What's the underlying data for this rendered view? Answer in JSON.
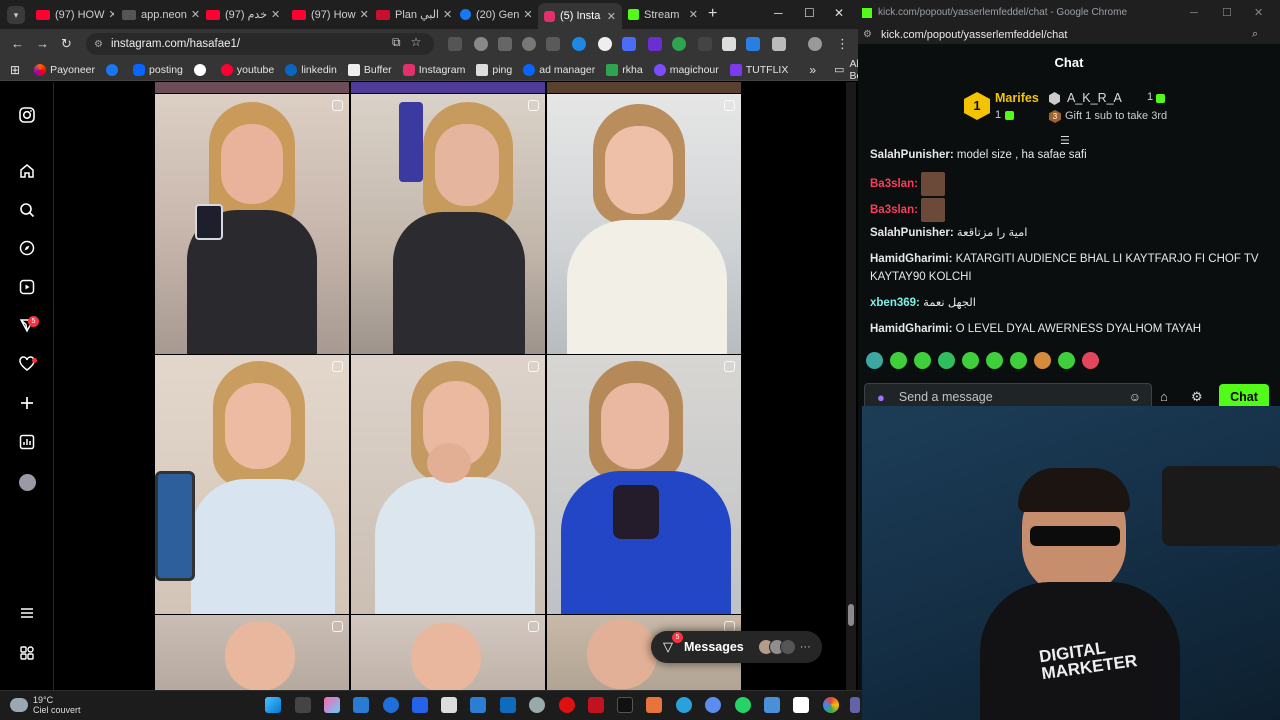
{
  "browser_left": {
    "tabs": [
      {
        "label": "(97) HOW",
        "fav": "#ff0033"
      },
      {
        "label": "app.neon",
        "fav": "#2b2b2b"
      },
      {
        "label": "(97) خدم",
        "fav": "#ff0033"
      },
      {
        "label": "(97) How",
        "fav": "#ff0033"
      },
      {
        "label": "Plan البي",
        "fav": "#c8102e"
      },
      {
        "label": "(20) Gen",
        "fav": "#1877f2"
      },
      {
        "label": "(5) Insta",
        "fav": "#e1306c"
      },
      {
        "label": "Stream",
        "fav": "#53fc18"
      }
    ],
    "url": "instagram.com/hasafae1/",
    "bookmarks": [
      "Payoneer",
      "posting",
      "youtube",
      "linkedin",
      "Buffer",
      "Instagram",
      "ping",
      "ad manager",
      "rkha",
      "magichour",
      "TUTFLIX"
    ],
    "all_bookmarks": "All Bookmarks",
    "overflow_glyph": "»"
  },
  "instagram": {
    "notifications_badge": "5",
    "messages_label": "Messages",
    "messages_badge": "5"
  },
  "chat_window": {
    "title": "kick.com/popout/yasserlemfeddel/chat - Google Chrome",
    "url": "kick.com/popout/yasserlemfeddel/chat",
    "header": "Chat",
    "leaderboard": {
      "first_rank": "1",
      "first_name": "Marifes",
      "first_count": "1",
      "second_name": "A_K_R_A",
      "second_count": "1",
      "third_rank": "3",
      "third_text": "Gift 1 sub to take 3rd"
    },
    "messages": [
      {
        "user": "SalahPunisher",
        "color": "#e8e8e8",
        "text": "model size , ha safae safi"
      },
      {
        "user": "Ba3slan",
        "color": "#ff3b5c",
        "text": "",
        "emote": true
      },
      {
        "user": "Ba3slan",
        "color": "#ff3b5c",
        "text": "",
        "emote": true
      },
      {
        "user": "SalahPunisher",
        "color": "#e8e8e8",
        "text": "امية را مزتاقعة"
      },
      {
        "user": "HamidGharimi",
        "color": "#e8e8e8",
        "text": "KATARGITI AUDIENCE BHAL LI KAYTFARJO FI CHOF TV KAYTAY90 KOLCHI"
      },
      {
        "user": "xben369",
        "color": "#7ff0e8",
        "text": "الجهل نعمة"
      },
      {
        "user": "HamidGharimi",
        "color": "#e8e8e8",
        "text": "O LEVEL DYAL AWERNESS DYALHOM TAYAH"
      }
    ],
    "input_placeholder": "Send a message",
    "send_label": "Chat"
  },
  "taskbar": {
    "temperature": "19°C",
    "condition": "Ciel couvert"
  }
}
